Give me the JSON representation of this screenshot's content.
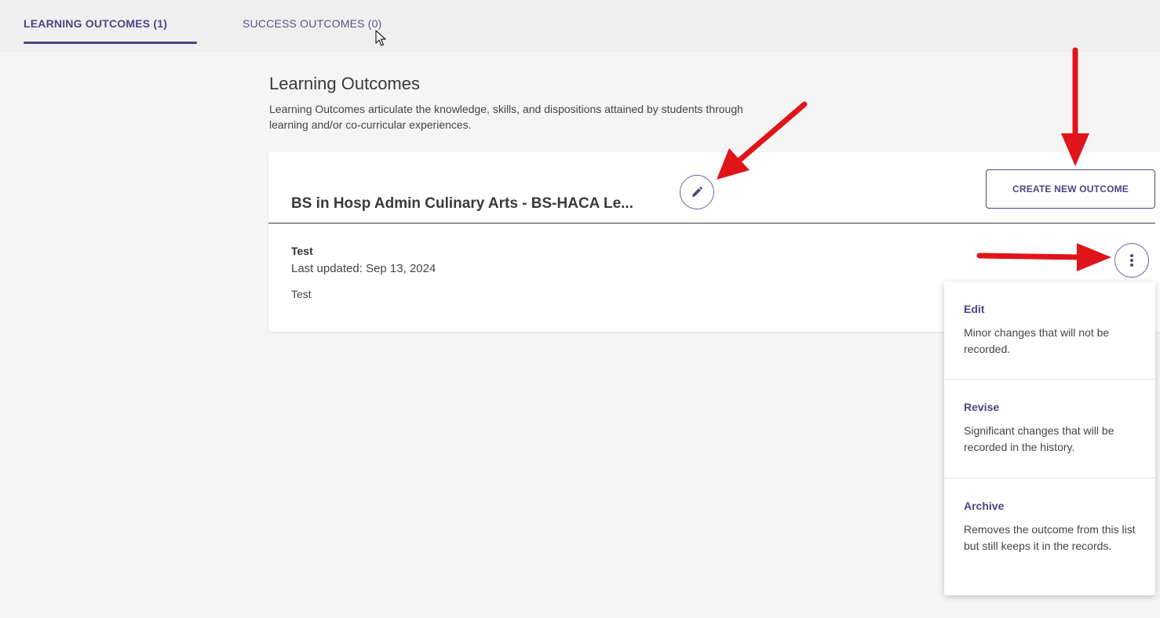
{
  "tabs": [
    {
      "label": "LEARNING OUTCOMES (1)",
      "active": true
    },
    {
      "label": "SUCCESS OUTCOMES (0)",
      "active": false
    }
  ],
  "main": {
    "heading": "Learning Outcomes",
    "description": "Learning Outcomes articulate the knowledge, skills, and dispositions attained by students through learning and/or co-curricular experiences."
  },
  "card": {
    "title": "BS in Hosp Admin Culinary Arts - BS-HACA Le...",
    "create_button": "CREATE NEW OUTCOME",
    "outcome": {
      "title": "Test",
      "updated": "Last updated: Sep 13, 2024",
      "description": "Test"
    }
  },
  "menu": [
    {
      "title": "Edit",
      "description": "Minor changes that will not be recorded."
    },
    {
      "title": "Revise",
      "description": "Significant changes that will be recorded in the history."
    },
    {
      "title": "Archive",
      "description": "Removes the outcome from this list but still keeps it in the records."
    }
  ],
  "colors": {
    "accent": "#4e4580",
    "annotation_arrow": "#e0141a",
    "background": "#f5f5f5"
  },
  "icons": {
    "edit_title": "pencil-icon",
    "more_options": "kebab-menu-icon",
    "pointer": "mouse-cursor-icon"
  }
}
